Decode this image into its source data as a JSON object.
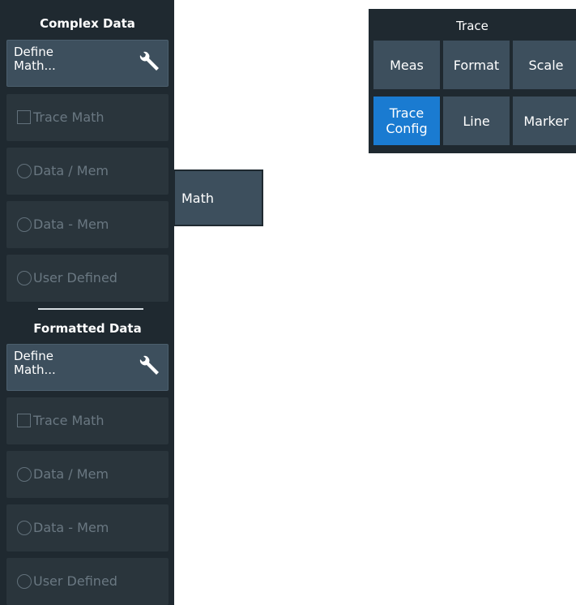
{
  "left_panel": {
    "complex_data": {
      "title": "Complex Data",
      "define_math": "Define\nMath...",
      "trace_math": "Trace Math",
      "data_div_mem": "Data / Mem",
      "data_minus_mem": "Data - Mem",
      "user_defined": "User Defined"
    },
    "formatted_data": {
      "title": "Formatted Data",
      "define_math": "Define\nMath...",
      "trace_math": "Trace Math",
      "data_div_mem": "Data / Mem",
      "data_minus_mem": "Data - Mem",
      "user_defined": "User Defined"
    }
  },
  "math_tab": {
    "label": "Math"
  },
  "trace_panel": {
    "title": "Trace",
    "buttons": [
      {
        "label": "Meas"
      },
      {
        "label": "Format"
      },
      {
        "label": "Scale"
      },
      {
        "label": "Trace\nConfig"
      },
      {
        "label": "Line"
      },
      {
        "label": "Marker"
      }
    ]
  },
  "colors": {
    "panel_bg": "#1f2930",
    "button_active": "#3d4f5d",
    "button_disabled": "#2a353c",
    "selected_blue": "#1a7bd1"
  },
  "icons": {
    "define_math": "wrench-icon"
  }
}
